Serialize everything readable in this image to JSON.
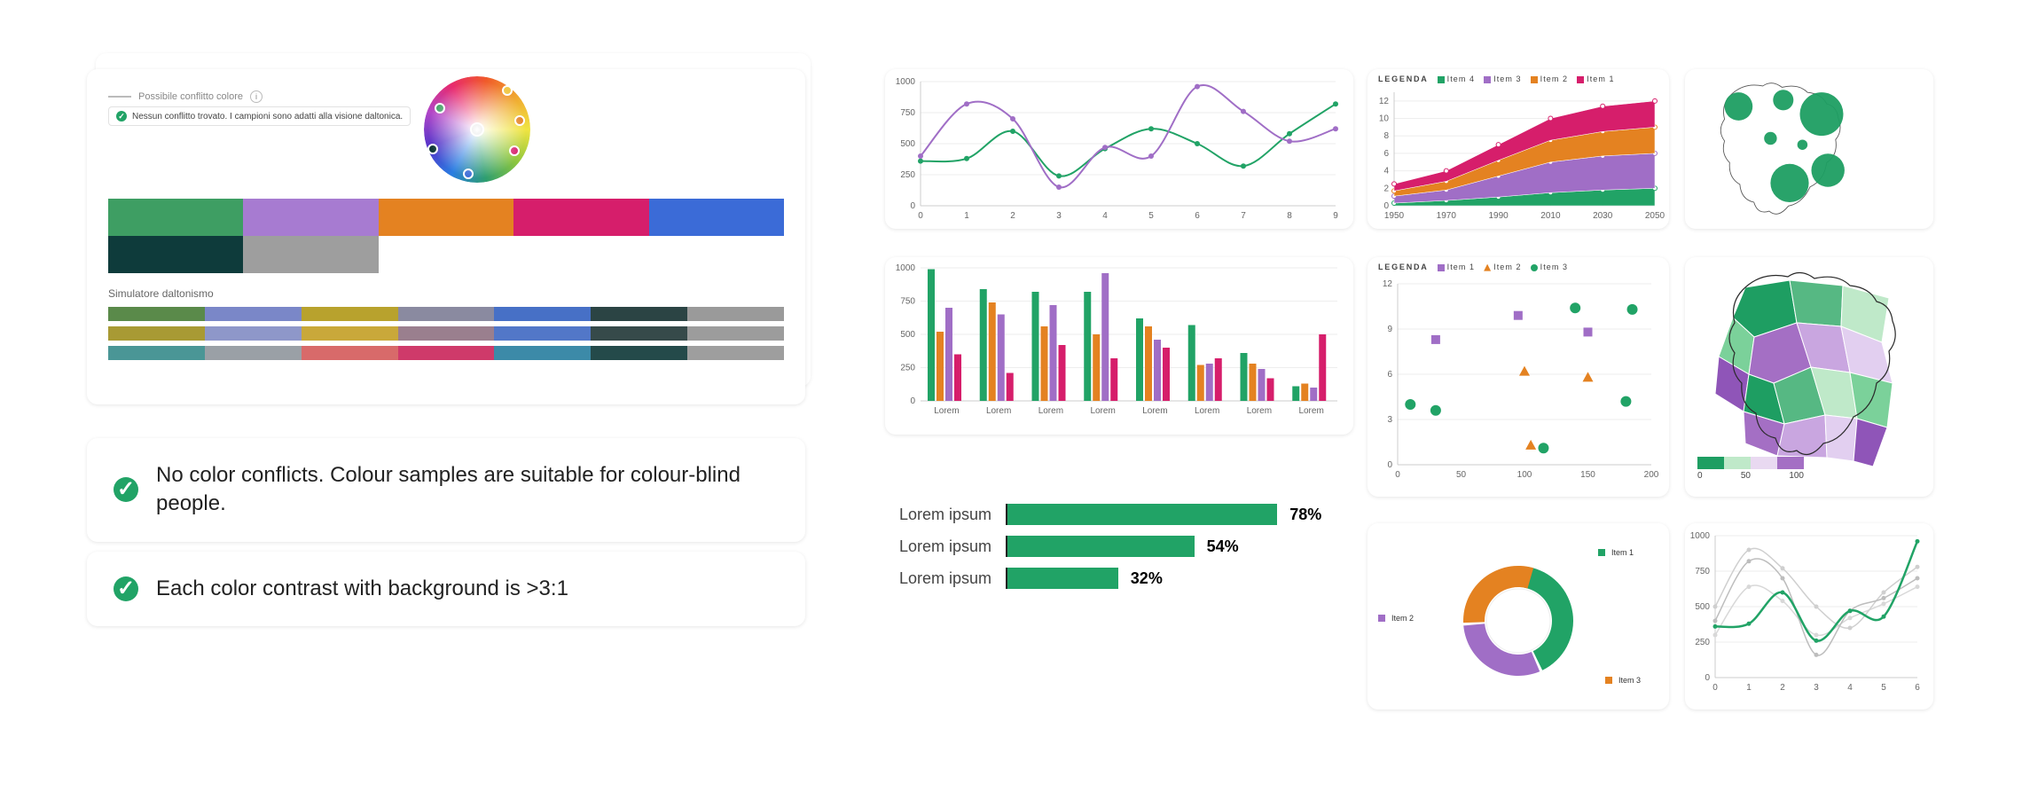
{
  "left_panel": {
    "conflict_label": "Possibile conflitto colore",
    "ok_chip": "Nessun conflitto trovato. I campioni sono adatti alla visione daltonica.",
    "sim_label": "Simulatore daltonismo",
    "swatches": [
      "#3e9e63",
      "#a77bd1",
      "#e48221",
      "#d61e6b",
      "#3b6bd7",
      "#0e3b3b",
      "#9e9e9e"
    ],
    "sim_rows": [
      [
        "#5a8a4a",
        "#7a87c8",
        "#b8a22d",
        "#8a8aa0",
        "#4770c6",
        "#2b4444",
        "#9a9a9a"
      ],
      [
        "#a89a34",
        "#8e97c9",
        "#c9a83a",
        "#9a7f8e",
        "#5277c8",
        "#364a4a",
        "#9c9c9c"
      ],
      [
        "#4a9696",
        "#9aa0a6",
        "#d86a6a",
        "#cf3a6a",
        "#3c8aa8",
        "#244a4a",
        "#9e9e9e"
      ]
    ]
  },
  "messages": {
    "msg1": "No color conflicts. Colour samples are suitable for colour-blind people.",
    "msg2": "Each color contrast with background is >3:1"
  },
  "colors": {
    "green": "#21a366",
    "purple": "#a06ec6",
    "orange": "#e48221",
    "magenta": "#d61e6b",
    "blue": "#3b6bd7"
  },
  "legend_word": "LEGENDA",
  "legend_items": {
    "area": [
      "Item 4",
      "Item 3",
      "Item 2",
      "Item 1"
    ],
    "scatter": [
      "Item 1",
      "Item 2",
      "Item 3"
    ]
  },
  "donut": {
    "labels": [
      "Item 1",
      "Item 2",
      "Item 3"
    ]
  },
  "chart_data": [
    {
      "id": "line_multi",
      "type": "line",
      "x": [
        0,
        1,
        2,
        3,
        4,
        5,
        6,
        7,
        8,
        9
      ],
      "xticks": [
        0,
        1,
        2,
        3,
        4,
        5,
        6,
        7,
        8,
        9
      ],
      "yticks": [
        0,
        250,
        500,
        750,
        1000
      ],
      "ylim": [
        0,
        1000
      ],
      "series": [
        {
          "name": "green",
          "color": "#21a366",
          "values": [
            360,
            380,
            600,
            240,
            460,
            620,
            500,
            320,
            580,
            820
          ]
        },
        {
          "name": "purple",
          "color": "#a06ec6",
          "values": [
            400,
            820,
            700,
            150,
            470,
            400,
            960,
            760,
            520,
            620
          ]
        }
      ]
    },
    {
      "id": "area_stacked",
      "type": "area",
      "x": [
        1950,
        1970,
        1990,
        2010,
        2030,
        2050
      ],
      "xticks": [
        1950,
        1970,
        1990,
        2010,
        2030,
        2050
      ],
      "yticks": [
        0,
        2,
        4,
        6,
        8,
        10,
        12
      ],
      "ylim": [
        0,
        13
      ],
      "legend_label": "LEGENDA",
      "series": [
        {
          "name": "Item 4",
          "color": "#21a366",
          "values": [
            0.3,
            0.6,
            1.0,
            1.5,
            1.8,
            2.0
          ]
        },
        {
          "name": "Item 3",
          "color": "#a06ec6",
          "values": [
            0.8,
            1.2,
            2.4,
            3.5,
            3.9,
            4.0
          ]
        },
        {
          "name": "Item 2",
          "color": "#e48221",
          "values": [
            0.6,
            1.0,
            1.8,
            2.5,
            2.8,
            3.0
          ]
        },
        {
          "name": "Item 1",
          "color": "#d61e6b",
          "values": [
            0.8,
            1.2,
            1.8,
            2.5,
            2.9,
            3.0
          ]
        }
      ],
      "stack_top": [
        2.5,
        4.0,
        7.0,
        10.0,
        11.4,
        12.0
      ]
    },
    {
      "id": "grouped_bars",
      "type": "bar",
      "categories": [
        "Lorem",
        "Lorem",
        "Lorem",
        "Lorem",
        "Lorem",
        "Lorem",
        "Lorem",
        "Lorem"
      ],
      "yticks": [
        0,
        250,
        500,
        750,
        1000
      ],
      "ylim": [
        0,
        1000
      ],
      "series": [
        {
          "name": "green",
          "color": "#21a366",
          "values": [
            990,
            840,
            820,
            820,
            620,
            570,
            360,
            110
          ]
        },
        {
          "name": "orange",
          "color": "#e48221",
          "values": [
            520,
            740,
            560,
            500,
            560,
            270,
            280,
            130
          ]
        },
        {
          "name": "purple",
          "color": "#a06ec6",
          "values": [
            700,
            650,
            720,
            960,
            460,
            280,
            240,
            100
          ]
        },
        {
          "name": "magenta",
          "color": "#d61e6b",
          "values": [
            350,
            210,
            420,
            320,
            400,
            320,
            170,
            500
          ]
        }
      ]
    },
    {
      "id": "scatter",
      "type": "scatter",
      "xticks": [
        0,
        50,
        100,
        150,
        200
      ],
      "yticks": [
        0,
        3,
        6,
        9,
        12
      ],
      "xlim": [
        0,
        200
      ],
      "ylim": [
        0,
        12
      ],
      "legend_label": "LEGENDA",
      "series": [
        {
          "name": "Item 1",
          "shape": "square",
          "color": "#a06ec6",
          "points": [
            [
              30,
              8.3
            ],
            [
              95,
              9.9
            ],
            [
              150,
              8.8
            ]
          ]
        },
        {
          "name": "Item 2",
          "shape": "triangle",
          "color": "#e48221",
          "points": [
            [
              100,
              6.2
            ],
            [
              150,
              5.8
            ],
            [
              105,
              1.3
            ]
          ]
        },
        {
          "name": "Item 3",
          "shape": "circle",
          "color": "#21a366",
          "points": [
            [
              10,
              4.0
            ],
            [
              30,
              3.6
            ],
            [
              140,
              10.4
            ],
            [
              185,
              10.3
            ],
            [
              180,
              4.2
            ],
            [
              115,
              1.1
            ]
          ]
        }
      ]
    },
    {
      "id": "hbars",
      "type": "bar",
      "orientation": "horizontal",
      "xlim": [
        0,
        100
      ],
      "items": [
        {
          "label": "Lorem ipsum",
          "value": 78
        },
        {
          "label": "Lorem ipsum",
          "value": 54
        },
        {
          "label": "Lorem ipsum",
          "value": 32
        }
      ]
    },
    {
      "id": "donut",
      "type": "pie",
      "slices": [
        {
          "name": "Item 1",
          "color": "#21a366",
          "value": 40
        },
        {
          "name": "Item 2",
          "color": "#a06ec6",
          "value": 30
        },
        {
          "name": "Item 3",
          "color": "#e48221",
          "value": 30
        }
      ]
    },
    {
      "id": "line_small",
      "type": "line",
      "x": [
        0,
        1,
        2,
        3,
        4,
        5,
        6
      ],
      "xticks": [
        0,
        1,
        2,
        3,
        4,
        5,
        6
      ],
      "yticks": [
        0,
        250,
        500,
        750,
        1000
      ],
      "ylim": [
        0,
        1000
      ],
      "series": [
        {
          "name": "green",
          "color": "#21a366",
          "values": [
            360,
            380,
            600,
            260,
            470,
            430,
            960
          ]
        },
        {
          "name": "gray1",
          "color": "#bdbdbd",
          "values": [
            400,
            820,
            700,
            160,
            470,
            560,
            700
          ]
        },
        {
          "name": "gray2",
          "color": "#cfcfcf",
          "values": [
            500,
            900,
            770,
            500,
            350,
            600,
            780
          ]
        },
        {
          "name": "gray3",
          "color": "#d8d8d8",
          "values": [
            300,
            640,
            540,
            300,
            420,
            520,
            640
          ]
        }
      ]
    },
    {
      "id": "map_bubble",
      "type": "map",
      "region": "Brazil",
      "bubbles": [
        {
          "r": 26
        },
        {
          "r": 18
        },
        {
          "r": 40
        },
        {
          "r": 14
        },
        {
          "r": 10
        },
        {
          "r": 30
        },
        {
          "r": 36
        }
      ]
    },
    {
      "id": "map_choropleth",
      "type": "map",
      "region": "Brazil",
      "scale": {
        "ticks": [
          0,
          50,
          100
        ],
        "colors": [
          "#1e9e62",
          "#bfe9c9",
          "#e9d9f1",
          "#a46fc4"
        ]
      }
    }
  ]
}
